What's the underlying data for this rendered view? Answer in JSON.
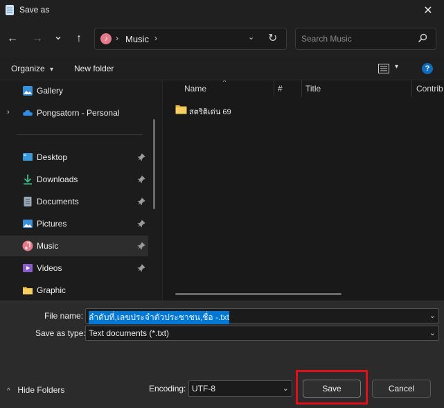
{
  "window": {
    "title": "Save as",
    "close_glyph": "✕"
  },
  "nav": {
    "back_glyph": "←",
    "forward_glyph": "→",
    "history_glyph": "⌄",
    "up_glyph": "↑",
    "address": {
      "location_icon": "music-note-icon",
      "breadcrumb": "Music",
      "separator": "›",
      "dropdown_glyph": "⌄",
      "refresh_glyph": "↻"
    },
    "search": {
      "placeholder": "Search Music",
      "icon": "search-icon"
    }
  },
  "toolbar": {
    "organize_label": "Organize",
    "organize_dd": "▾",
    "new_folder_label": "New folder",
    "view_icon": "list-view-icon",
    "view_dd": "▾",
    "help_glyph": "?"
  },
  "sidebar": {
    "items": [
      {
        "label": "Gallery",
        "icon": "gallery-icon",
        "pinned": false
      },
      {
        "label": "Pongsatorn - Personal",
        "icon": "onedrive-cloud-icon",
        "pinned": false,
        "expander": "›"
      },
      {
        "label": "Desktop",
        "icon": "desktop-icon",
        "pinned": true
      },
      {
        "label": "Downloads",
        "icon": "download-icon",
        "pinned": true
      },
      {
        "label": "Documents",
        "icon": "document-icon",
        "pinned": true
      },
      {
        "label": "Pictures",
        "icon": "picture-icon",
        "pinned": true
      },
      {
        "label": "Music",
        "icon": "music-note-icon",
        "pinned": true,
        "selected": true
      },
      {
        "label": "Videos",
        "icon": "video-icon",
        "pinned": true
      },
      {
        "label": "Graphic",
        "icon": "folder-icon",
        "pinned": false
      }
    ]
  },
  "content": {
    "columns": [
      "Name",
      "#",
      "Title",
      "Contrib"
    ],
    "sort_glyph": "^",
    "files": [
      {
        "name": "สตริติเด่น 69",
        "icon": "folder-icon"
      }
    ]
  },
  "save_panel": {
    "filename_label": "File name:",
    "filename_value": "ลำดับที่,เลขประจำตัวประชาชน,ชื่อ -.txt",
    "save_as_type_label": "Save as type:",
    "save_as_type_value": "Text documents (*.txt)",
    "encoding_label": "Encoding:",
    "encoding_value": "UTF-8",
    "hide_folders_label": "Hide Folders",
    "hide_folders_glyph": "^",
    "combo_glyph": "⌄",
    "save_label": "Save",
    "cancel_label": "Cancel"
  },
  "colors": {
    "accent": "#0078d4",
    "highlight": "#e0101b",
    "background": "#1c1c1c"
  }
}
